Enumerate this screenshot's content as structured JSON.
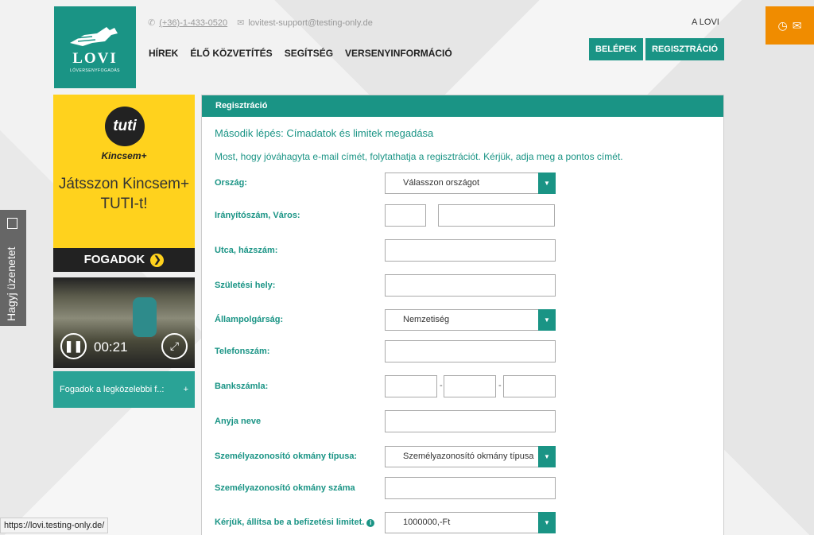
{
  "header": {
    "logo_name": "LOVI",
    "logo_sub": "LÓVERSENYFOGADÁS",
    "phone": "(+36)-1-433-0520",
    "email": "lovitest-support@testing-only.de",
    "top_right_text": "A LOVI",
    "nav": [
      "HÍREK",
      "ÉLŐ KÖZVETÍTÉS",
      "SEGÍTSÉG",
      "VERSENYINFORMÁCIÓ"
    ],
    "login_label": "BELÉPEK",
    "register_label": "REGISZTRÁCIÓ"
  },
  "side_message_label": "Hagyj üzenetet",
  "ad": {
    "logo_text": "tuti",
    "brand": "Kincsem+",
    "headline": "Játsszon Kincsem+ TUTI-t!",
    "cta": "FOGADOK",
    "cta_icon": "❯"
  },
  "video": {
    "time": "00:21"
  },
  "next_races": {
    "label": "Fogadok a legközelebbi f..:",
    "icon": "+"
  },
  "form": {
    "title": "Regisztráció",
    "step": "Második lépés: Címadatok és limitek megadása",
    "intro": "Most, hogy jóváhagyta e-mail címét, folytathatja a regisztrációt. Kérjük, adja meg a pontos címét.",
    "country_label": "Ország:",
    "country_value": "Válasszon országot",
    "zip_city_label": "Irányítószám, Város:",
    "street_label": "Utca, házszám:",
    "birthplace_label": "Születési hely:",
    "citizenship_label": "Állampolgárság:",
    "citizenship_value": "Nemzetiség",
    "phone_label": "Telefonszám:",
    "bank_label": "Bankszámla:",
    "bank_dash": "-",
    "mother_label": "Anyja neve",
    "id_type_label": "Személyazonosító okmány típusa:",
    "id_type_value": "Személyazonosító okmány típusa",
    "id_number_label": "Személyazonosító okmány száma",
    "limit_label": "Kérjük, állítsa be a befizetési limitet.",
    "limit_value": "1000000,-Ft"
  },
  "status_url": "https://lovi.testing-only.de/"
}
